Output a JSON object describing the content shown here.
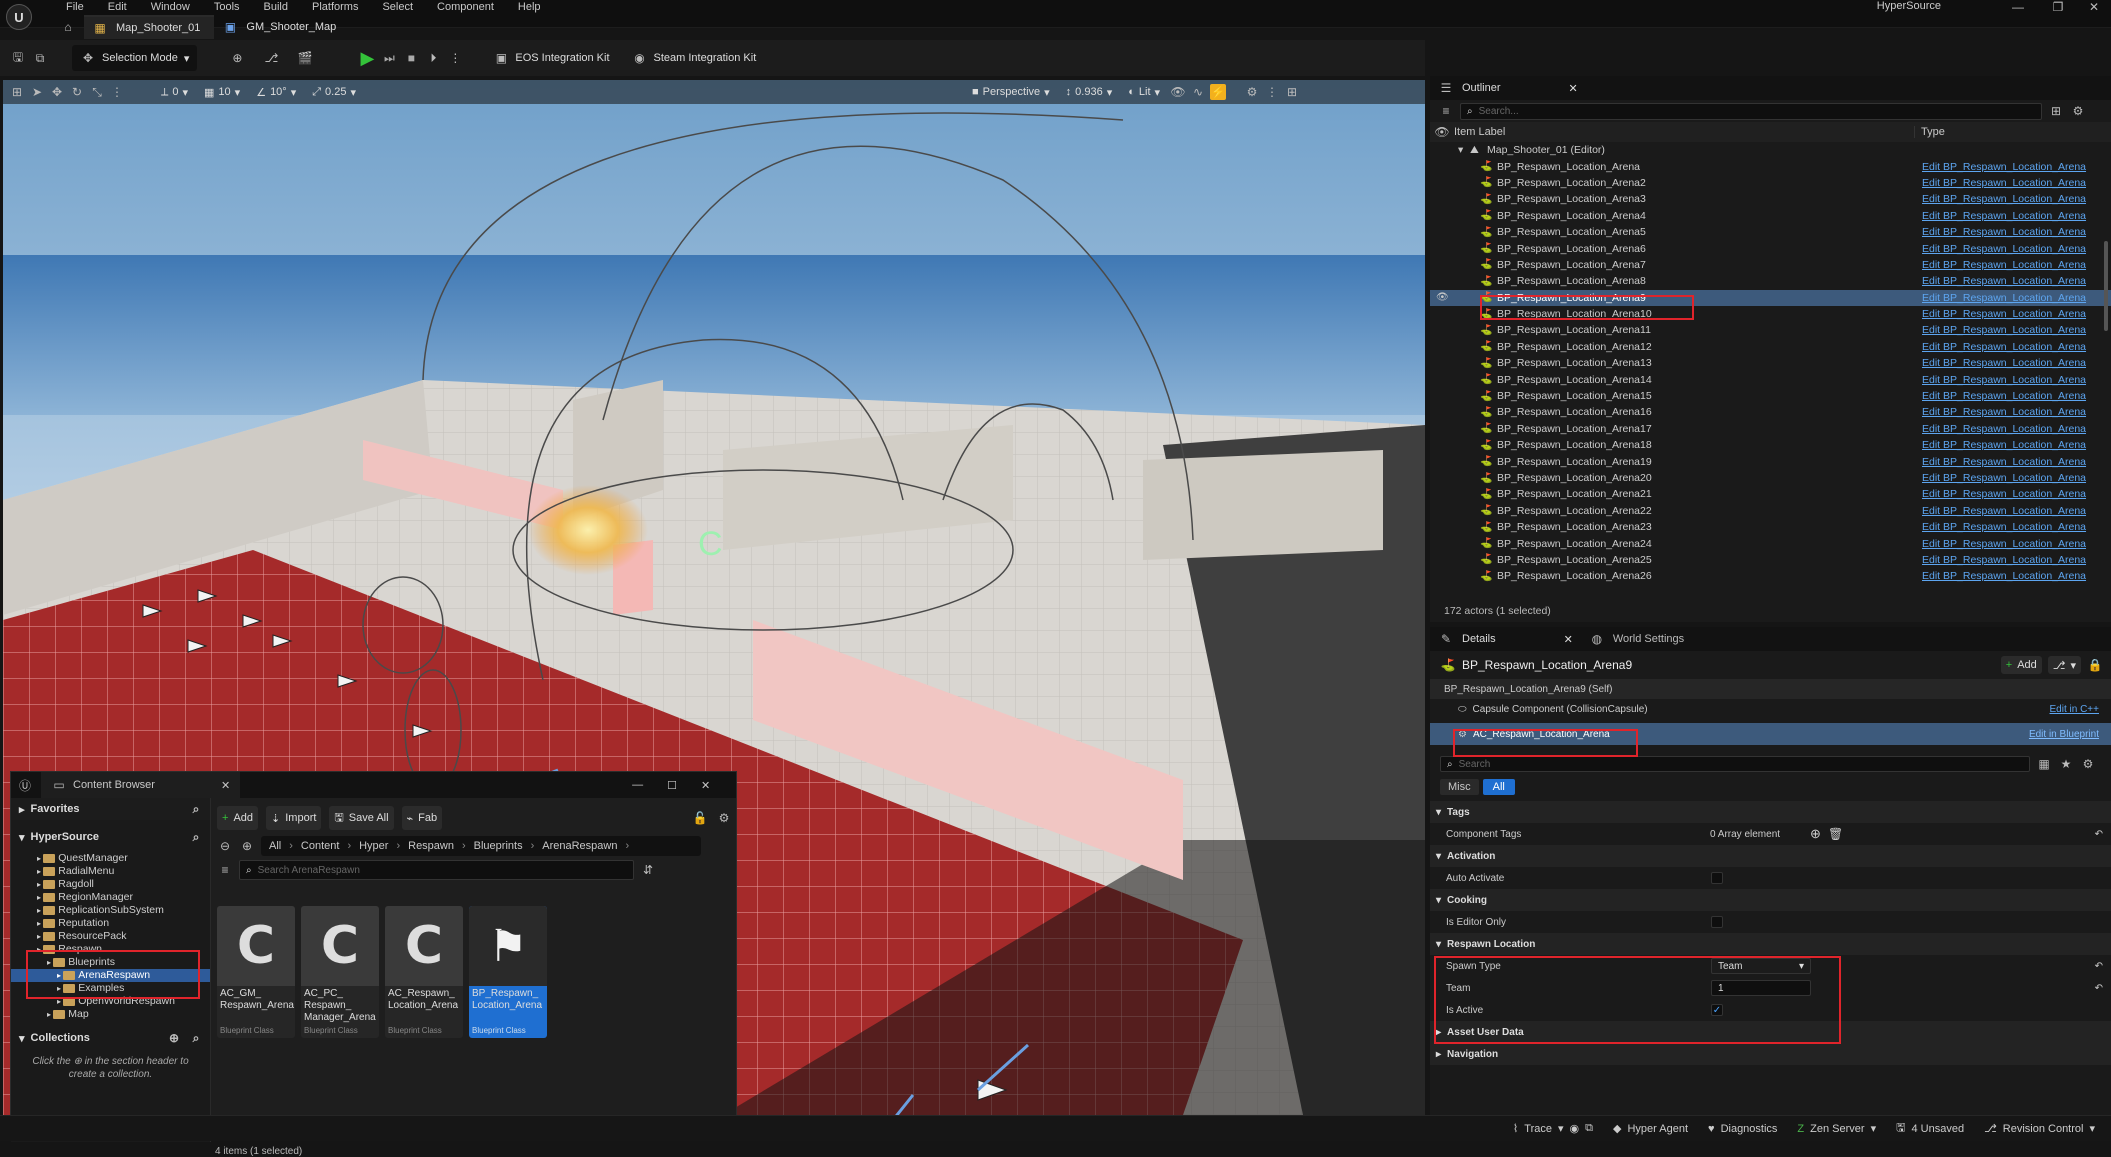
{
  "app": {
    "menu": [
      "File",
      "Edit",
      "Window",
      "Tools",
      "Build",
      "Platforms",
      "Select",
      "Component",
      "Help"
    ],
    "project_name": "HyperSource",
    "tabs": [
      "Map_Shooter_01",
      "GM_Shooter_Map"
    ]
  },
  "toolbar": {
    "mode_label": "Selection Mode",
    "eos_label": "EOS Integration Kit",
    "steam_label": "Steam Integration Kit"
  },
  "viewport": {
    "perspective": "Perspective",
    "fov": "0.936",
    "lit": "Lit",
    "snap_translate": "10",
    "snap_rotate": "10°",
    "snap_scale": "0.25",
    "snap_zero": "0"
  },
  "content_browser": {
    "title": "Content Browser",
    "favorites": "Favorites",
    "root": "HyperSource",
    "tree": [
      {
        "label": "QuestManager",
        "indent": 1,
        "sel": false
      },
      {
        "label": "RadialMenu",
        "indent": 1,
        "sel": false
      },
      {
        "label": "Ragdoll",
        "indent": 1,
        "sel": false
      },
      {
        "label": "RegionManager",
        "indent": 1,
        "sel": false
      },
      {
        "label": "ReplicationSubSystem",
        "indent": 1,
        "sel": false
      },
      {
        "label": "Reputation",
        "indent": 1,
        "sel": false
      },
      {
        "label": "ResourcePack",
        "indent": 1,
        "sel": false
      },
      {
        "label": "Respawn",
        "indent": 1,
        "sel": false
      },
      {
        "label": "Blueprints",
        "indent": 2,
        "sel": false
      },
      {
        "label": "ArenaRespawn",
        "indent": 3,
        "sel": true
      },
      {
        "label": "Examples",
        "indent": 3,
        "sel": false
      },
      {
        "label": "OpenWorldRespawn",
        "indent": 3,
        "sel": false
      },
      {
        "label": "Map",
        "indent": 2,
        "sel": false
      }
    ],
    "collections": "Collections",
    "collections_hint_a": "Click the",
    "collections_hint_b": "in the section header to create a collection.",
    "buttons": {
      "add": "Add",
      "import": "Import",
      "save_all": "Save All",
      "fab": "Fab"
    },
    "breadcrumb": [
      "All",
      "Content",
      "Hyper",
      "Respawn",
      "Blueprints",
      "ArenaRespawn"
    ],
    "search_placeholder": "Search ArenaRespawn",
    "assets": [
      {
        "name": "AC_GM_\nRespawn_Arena",
        "cls": "Blueprint Class",
        "selected": false,
        "kind": "C"
      },
      {
        "name": "AC_PC_\nRespawn_\nManager_Arena",
        "cls": "Blueprint Class",
        "selected": false,
        "kind": "C"
      },
      {
        "name": "AC_Respawn_\nLocation_Arena",
        "cls": "Blueprint Class",
        "selected": false,
        "kind": "C"
      },
      {
        "name": "BP_Respawn_\nLocation_Arena",
        "cls": "Blueprint Class",
        "selected": true,
        "kind": "flag"
      }
    ],
    "footer": "4 items (1 selected)"
  },
  "outliner": {
    "title": "Outliner",
    "search_placeholder": "Search...",
    "col_label": "Item Label",
    "col_type": "Type",
    "map_row": "Map_Shooter_01 (Editor)",
    "items": [
      {
        "label": "BP_Respawn_Location_Arena",
        "sel": false
      },
      {
        "label": "BP_Respawn_Location_Arena2",
        "sel": false
      },
      {
        "label": "BP_Respawn_Location_Arena3",
        "sel": false
      },
      {
        "label": "BP_Respawn_Location_Arena4",
        "sel": false
      },
      {
        "label": "BP_Respawn_Location_Arena5",
        "sel": false
      },
      {
        "label": "BP_Respawn_Location_Arena6",
        "sel": false
      },
      {
        "label": "BP_Respawn_Location_Arena7",
        "sel": false
      },
      {
        "label": "BP_Respawn_Location_Arena8",
        "sel": false
      },
      {
        "label": "BP_Respawn_Location_Arena9",
        "sel": true
      },
      {
        "label": "BP_Respawn_Location_Arena10",
        "sel": false
      },
      {
        "label": "BP_Respawn_Location_Arena11",
        "sel": false
      },
      {
        "label": "BP_Respawn_Location_Arena12",
        "sel": false
      },
      {
        "label": "BP_Respawn_Location_Arena13",
        "sel": false
      },
      {
        "label": "BP_Respawn_Location_Arena14",
        "sel": false
      },
      {
        "label": "BP_Respawn_Location_Arena15",
        "sel": false
      },
      {
        "label": "BP_Respawn_Location_Arena16",
        "sel": false
      },
      {
        "label": "BP_Respawn_Location_Arena17",
        "sel": false
      },
      {
        "label": "BP_Respawn_Location_Arena18",
        "sel": false
      },
      {
        "label": "BP_Respawn_Location_Arena19",
        "sel": false
      },
      {
        "label": "BP_Respawn_Location_Arena20",
        "sel": false
      },
      {
        "label": "BP_Respawn_Location_Arena21",
        "sel": false
      },
      {
        "label": "BP_Respawn_Location_Arena22",
        "sel": false
      },
      {
        "label": "BP_Respawn_Location_Arena23",
        "sel": false
      },
      {
        "label": "BP_Respawn_Location_Arena24",
        "sel": false
      },
      {
        "label": "BP_Respawn_Location_Arena25",
        "sel": false
      },
      {
        "label": "BP_Respawn_Location_Arena26",
        "sel": false
      }
    ],
    "type_link": "Edit BP_Respawn_Location_Arena",
    "footer": "172 actors (1 selected)"
  },
  "details": {
    "tab_details": "Details",
    "tab_world": "World Settings",
    "actor_name": "BP_Respawn_Location_Arena9",
    "add_label": "Add",
    "self_row": "BP_Respawn_Location_Arena9 (Self)",
    "capsule_row": "Capsule Component (CollisionCapsule)",
    "capsule_link": "Edit in C++",
    "component_row": "AC_Respawn_Location_Arena",
    "component_link": "Edit in Blueprint",
    "search_placeholder": "Search",
    "filter_misc": "Misc",
    "filter_all": "All",
    "cat_tags": "Tags",
    "component_tags": "Component Tags",
    "array_elements": "0 Array element",
    "cat_activation": "Activation",
    "auto_activate": "Auto Activate",
    "cat_cooking": "Cooking",
    "is_editor_only": "Is Editor Only",
    "cat_respawn": "Respawn Location",
    "spawn_type_label": "Spawn Type",
    "spawn_type_value": "Team",
    "team_label": "Team",
    "team_value": "1",
    "is_active_label": "Is Active",
    "is_active": true,
    "cat_asset_user": "Asset User Data",
    "cat_navigation": "Navigation"
  },
  "statusbar": {
    "trace": "Trace",
    "hyper_agent": "Hyper Agent",
    "diagnostics": "Diagnostics",
    "zen": "Zen Server",
    "unsaved": "4 Unsaved",
    "revision": "Revision Control"
  },
  "colors": {
    "accent": "#1f6fd1",
    "selection": "#3d5a7c",
    "link": "#5da5f0",
    "highlight_box": "#e0242b",
    "play": "#34c33a"
  }
}
